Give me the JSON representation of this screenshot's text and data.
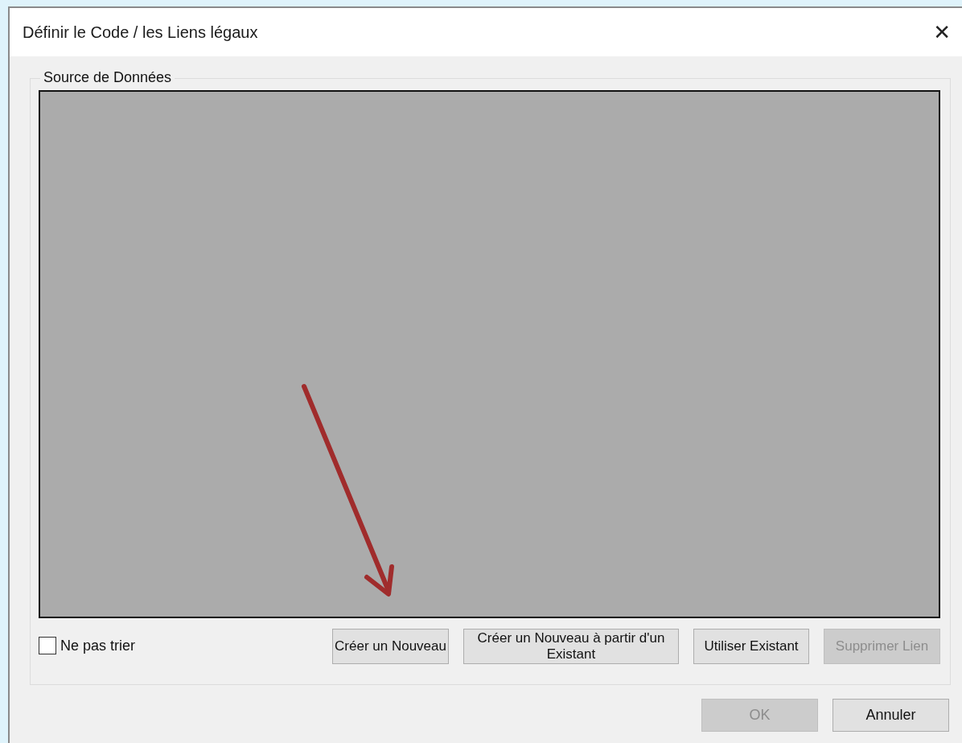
{
  "window": {
    "title": "Définir le Code / les Liens légaux",
    "close": "✕"
  },
  "group": {
    "label": "Source de Données"
  },
  "sort_option": {
    "label": "Ne pas trier",
    "checked": false
  },
  "actions": [
    {
      "label": "Créer un Nouveau",
      "disabled": false
    },
    {
      "label": "Créer un Nouveau à partir d'un Existant",
      "disabled": false
    },
    {
      "label": "Utiliser Existant",
      "disabled": false
    },
    {
      "label": "Supprimer Lien",
      "disabled": true
    }
  ],
  "dialog_buttons": [
    {
      "label": "OK",
      "disabled": true
    },
    {
      "label": "Annuler",
      "disabled": false
    }
  ]
}
